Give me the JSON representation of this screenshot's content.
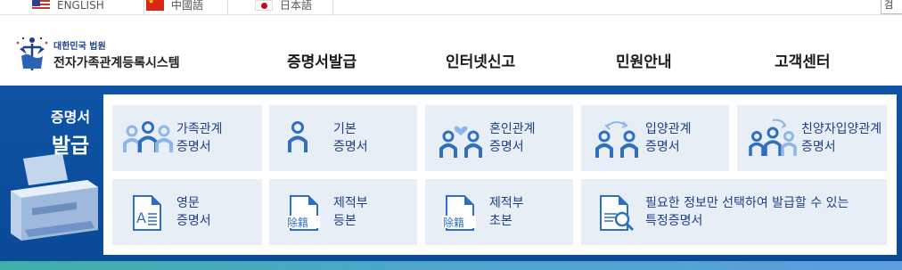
{
  "languages": [
    {
      "label": "ENGLISH",
      "flag": "us-flag-icon"
    },
    {
      "label": "中國語",
      "flag": "china-flag-icon"
    },
    {
      "label": "日本語",
      "flag": "japan-flag-icon"
    }
  ],
  "search_edge_text": "검",
  "logo": {
    "sub": "대한민국 법원",
    "main": "전자가족관계등록시스템"
  },
  "nav": [
    "증명서발급",
    "인터넷신고",
    "민원안내",
    "고객센터"
  ],
  "panel": {
    "line1": "증명서",
    "line2": "발급"
  },
  "cards_row1": [
    {
      "line1": "가족관계",
      "line2": "증명서",
      "icon": "family-people-icon"
    },
    {
      "line1": "기본",
      "line2": "증명서",
      "icon": "person-icon"
    },
    {
      "line1": "혼인관계",
      "line2": "증명서",
      "icon": "couple-heart-icon"
    },
    {
      "line1": "입양관계",
      "line2": "증명서",
      "icon": "adoption-arrows-icon"
    },
    {
      "line1": "친양자입양관계",
      "line2": "증명서",
      "icon": "full-adoption-icon"
    }
  ],
  "cards_row2": [
    {
      "line1": "영문",
      "line2": "증명서",
      "icon": "english-document-icon"
    },
    {
      "line1": "제적부",
      "line2": "등본",
      "icon": "removed-register-document-icon",
      "badge": "除籍"
    },
    {
      "line1": "제적부",
      "line2": "초본",
      "icon": "removed-register-extract-icon",
      "badge": "除籍"
    },
    {
      "line1": "필요한 정보만 선택하여 발급할 수 있는",
      "line2": "특정증명서",
      "icon": "document-search-icon"
    }
  ],
  "colors": {
    "brand_blue": "#0e53a5",
    "card_bg": "#e8eef6",
    "icon_blue": "#2f6fc2",
    "icon_light": "#8fb6e8",
    "label": "#1e3f85"
  }
}
